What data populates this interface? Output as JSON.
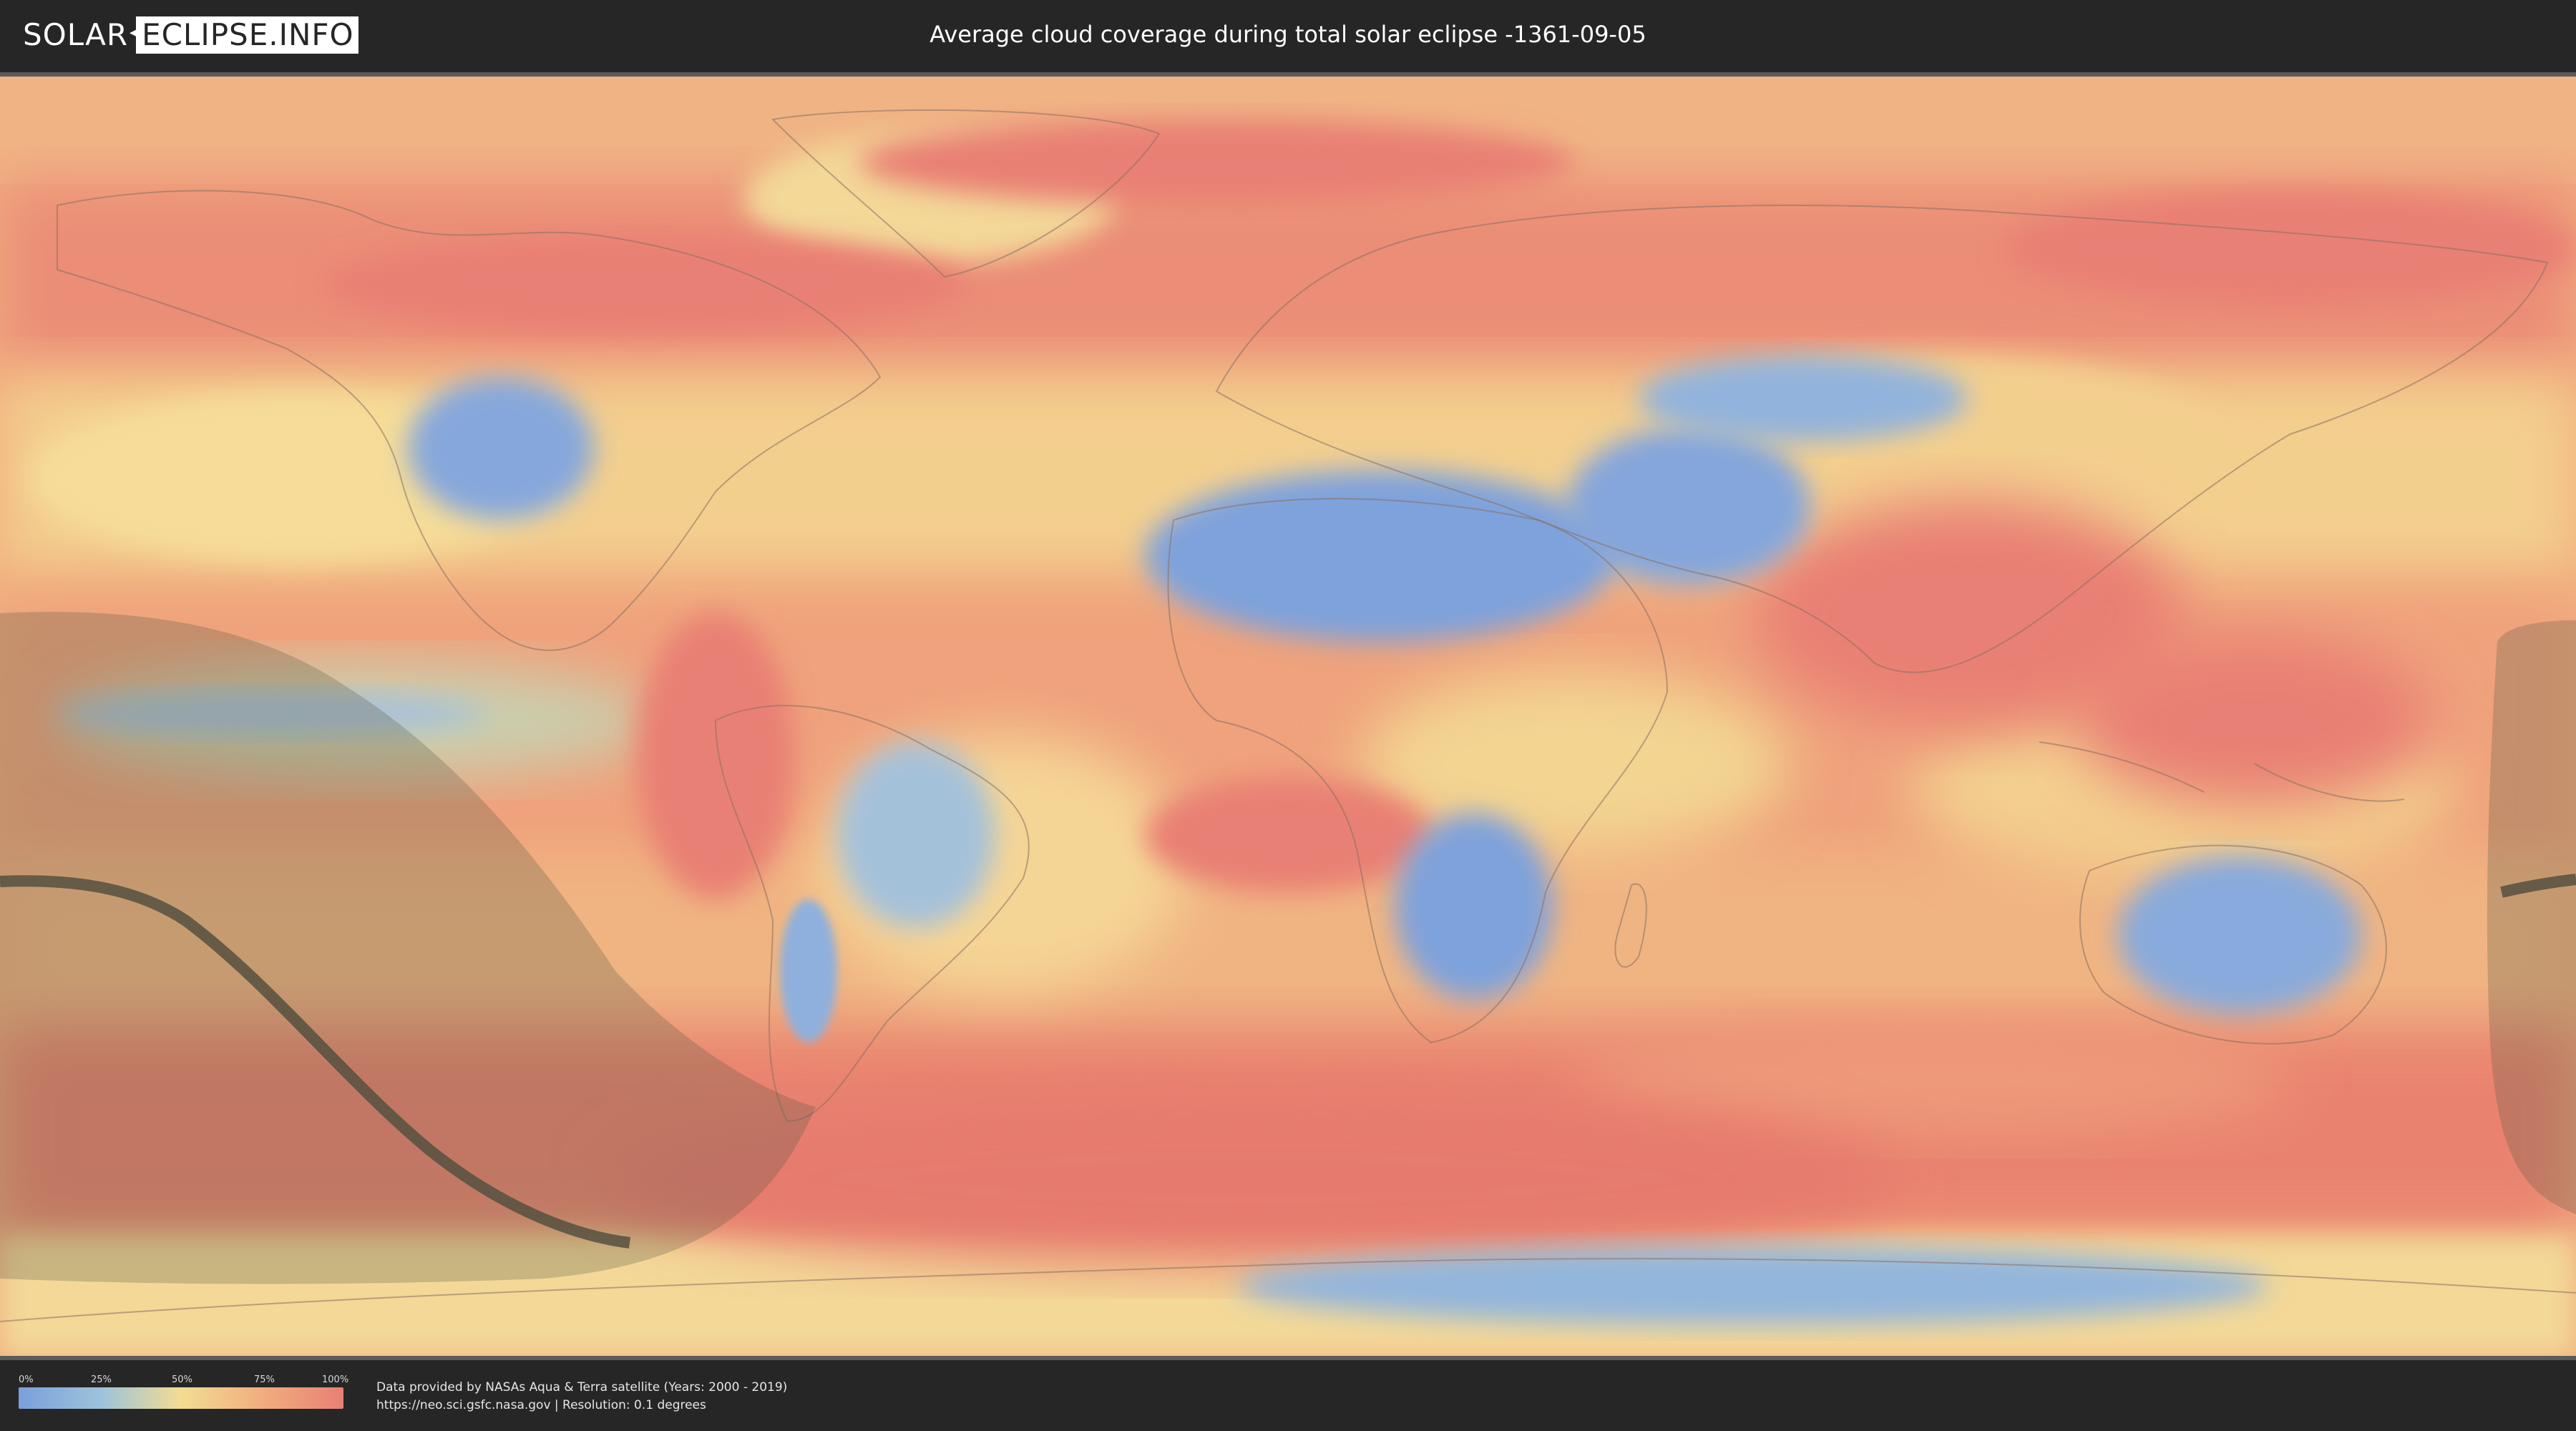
{
  "header": {
    "logo_left": "SOLAR",
    "logo_right": "ECLIPSE.INFO",
    "logo_icon": "small-eclipse-mark",
    "title": "Average cloud coverage during total solar eclipse -1361-09-05"
  },
  "map": {
    "projection": "equirectangular world map",
    "layers": [
      "cloud-coverage-raster",
      "country-borders",
      "eclipse-penumbra-shading",
      "eclipse-totality-path"
    ],
    "colors": {
      "clear": "#7aa0dc",
      "low": "#9cc2dc",
      "mid": "#f3dc92",
      "high": "#f1ad7f",
      "overcast": "#e98074",
      "eclipse_shadow": "#5a5a45",
      "totality_path": "#55503f"
    }
  },
  "legend": {
    "ticks": [
      "0%",
      "25%",
      "50%",
      "75%",
      "100%"
    ]
  },
  "credits": {
    "line1": "Data provided by NASAs Aqua & Terra satellite (Years: 2000 - 2019)",
    "line2": "https://neo.sci.gsfc.nasa.gov | Resolution: 0.1 degrees"
  }
}
